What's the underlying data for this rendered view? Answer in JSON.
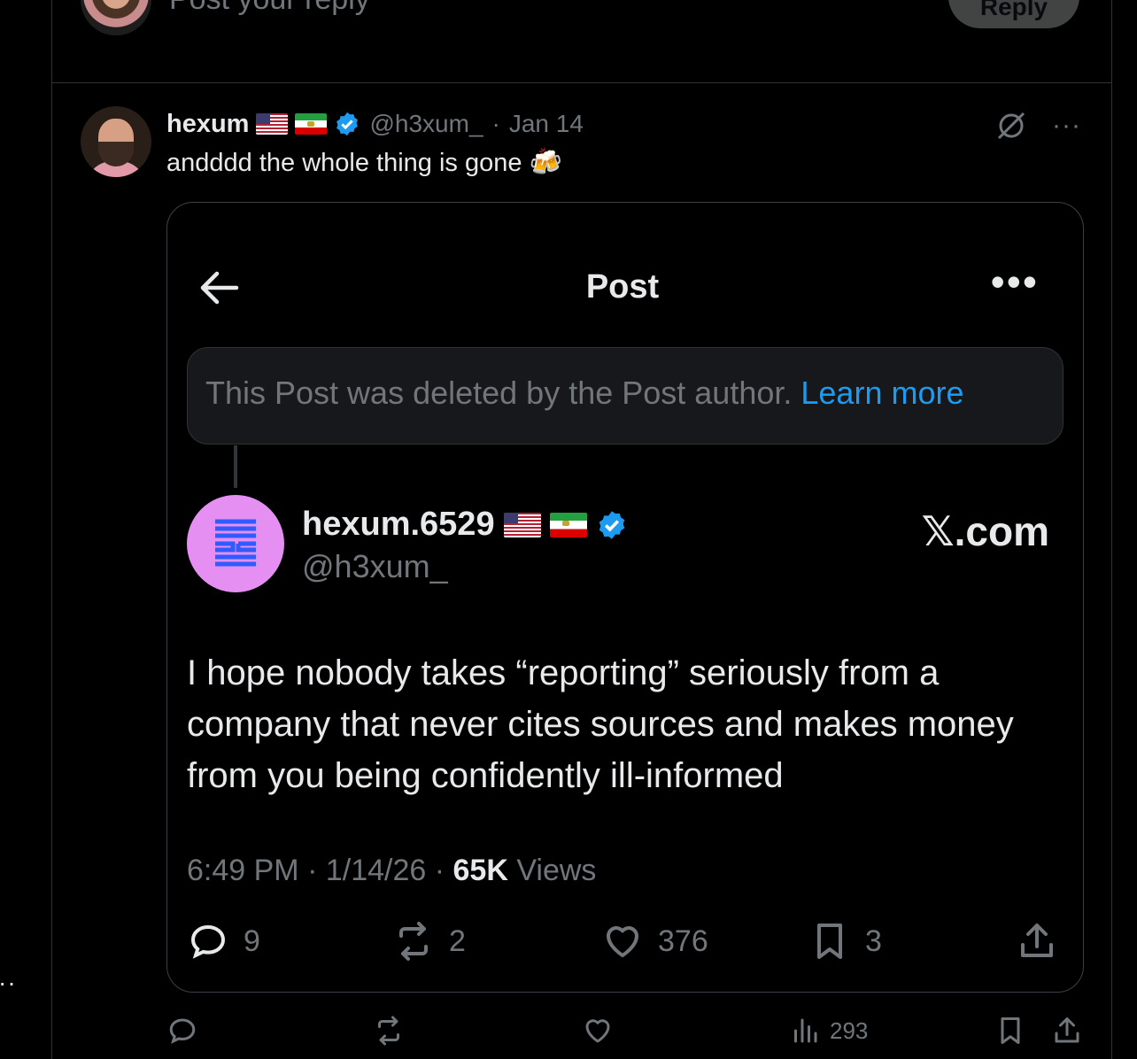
{
  "composer": {
    "placeholder": "Post your reply",
    "reply_label": "Reply"
  },
  "tweet": {
    "name": "hexum",
    "handle": "@h3xum_",
    "separator": "·",
    "date": "Jan 14",
    "more": "···",
    "text": "andddd the whole thing is gone",
    "emoji": "🍻"
  },
  "card": {
    "title": "Post",
    "more": "•••",
    "deleted_message": "This Post was deleted by the Post author. ",
    "learn_more": "Learn more",
    "quoted": {
      "name": "hexum.6529",
      "handle": "@h3xum_",
      "brand": "𝕏.com",
      "text": "I hope nobody takes “reporting” seriously from a company that never cites sources and makes money from you being confidently ill-informed",
      "time": "6:49 PM",
      "date": "1/14/26",
      "views_count": "65K",
      "views_label": "Views",
      "replies": "9",
      "reposts": "2",
      "likes": "376",
      "bookmarks": "3"
    }
  },
  "actions": {
    "views": "293"
  },
  "edge_dots": "··",
  "colors": {
    "background": "#000000",
    "text": "#e7e9ea",
    "muted": "#71767b",
    "link": "#1d9bf0",
    "border": "#2f3336",
    "quoted_avatar": "#e58ff2",
    "quoted_logo": "#2f5bff"
  }
}
